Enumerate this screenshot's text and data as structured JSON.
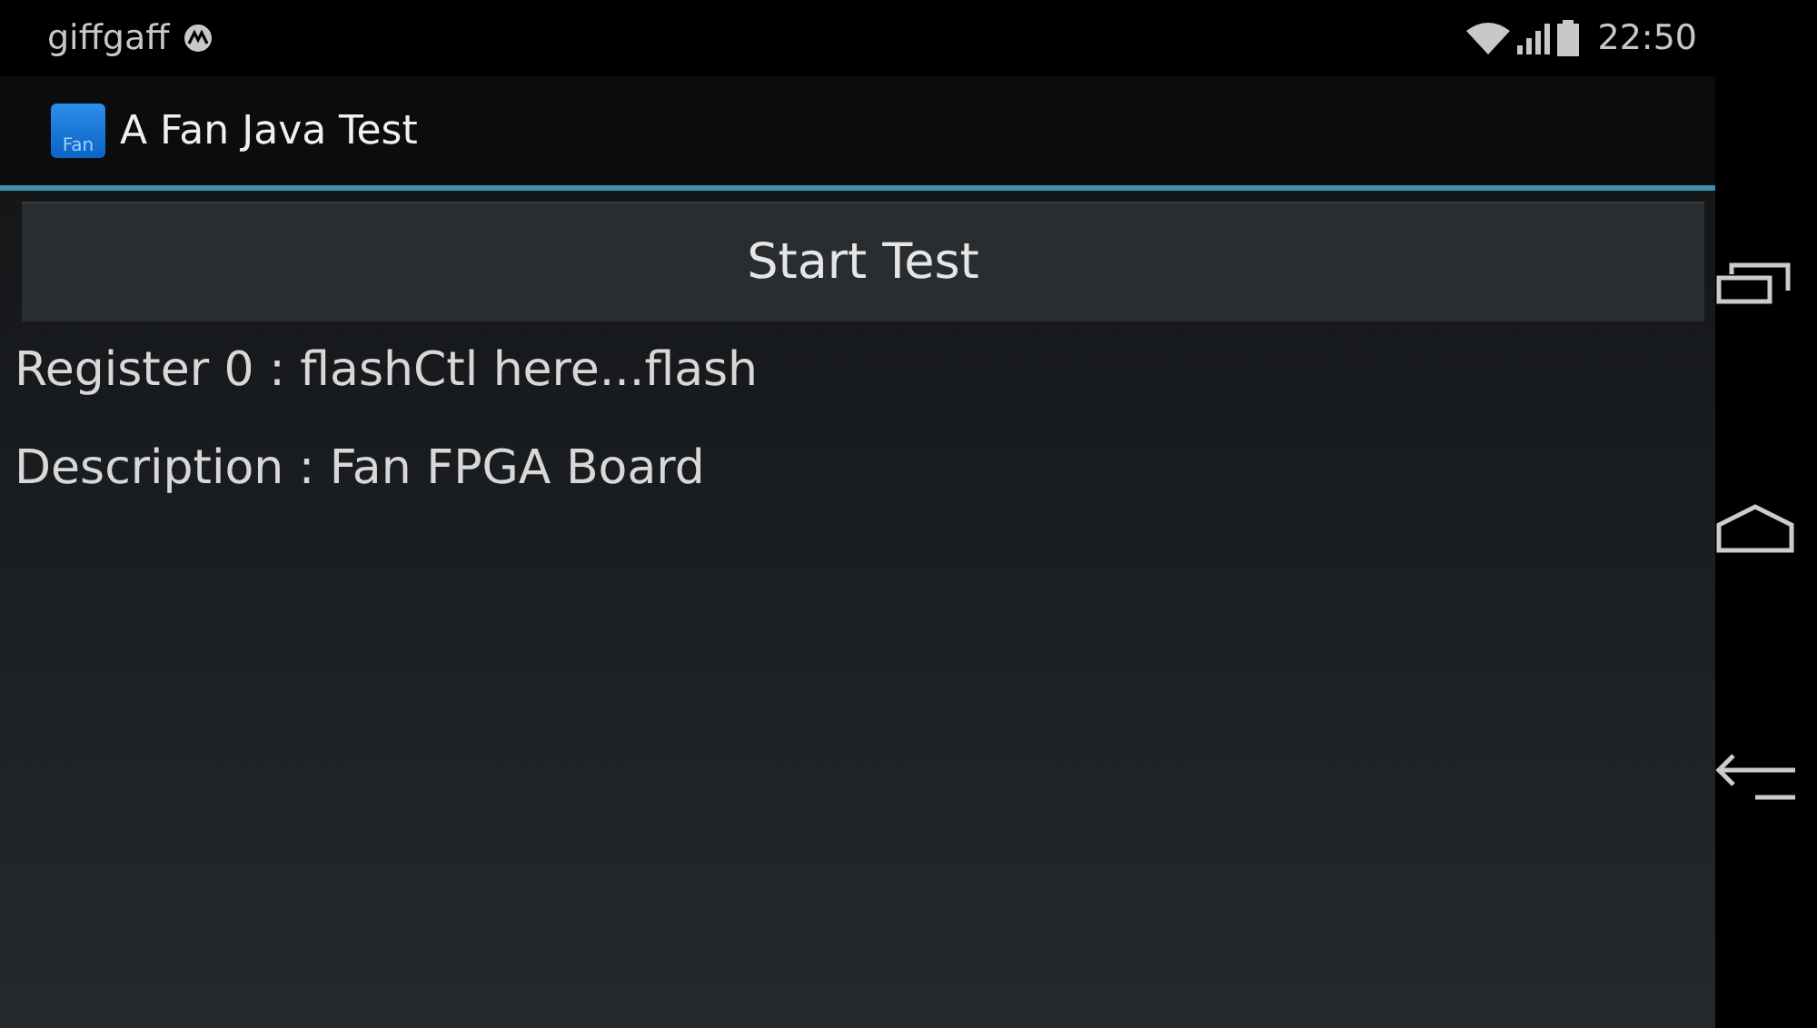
{
  "status_bar": {
    "carrier": "giffgaff",
    "time": "22:50"
  },
  "action_bar": {
    "icon_label": "Fan",
    "title": "A Fan Java Test"
  },
  "button": {
    "label": "Start Test"
  },
  "lines": [
    "Register 0 : flashCtl here...flash",
    "Description : Fan FPGA Board"
  ]
}
